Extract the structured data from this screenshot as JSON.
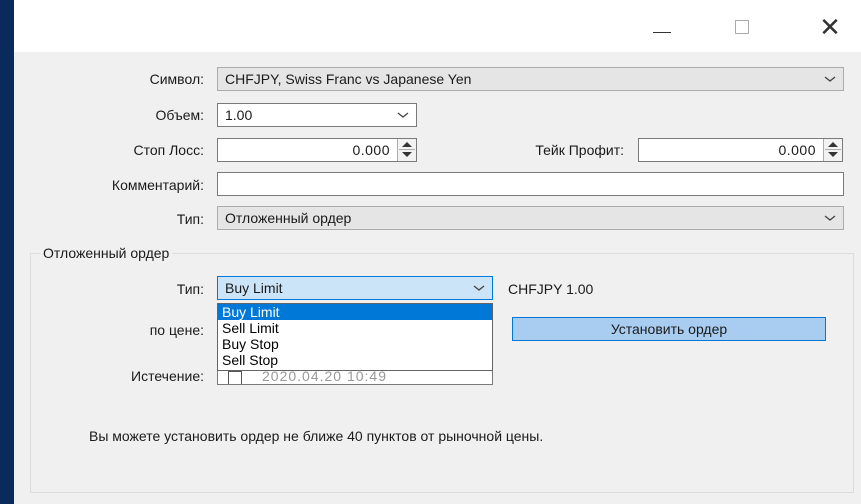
{
  "window": {
    "minimize_icon": "minimize-icon",
    "maximize_icon": "maximize-icon",
    "close_icon": "close-icon"
  },
  "form": {
    "symbol_label": "Символ:",
    "symbol_value": "CHFJPY, Swiss Franc vs Japanese Yen",
    "volume_label": "Объем:",
    "volume_value": "1.00",
    "stoploss_label": "Стоп Лосс:",
    "stoploss_value": "0.000",
    "takeprofit_label": "Тейк Профит:",
    "takeprofit_value": "0.000",
    "comment_label": "Комментарий:",
    "comment_value": "",
    "type_label": "Тип:",
    "type_value": "Отложенный ордер"
  },
  "pending": {
    "group_title": "Отложенный ордер",
    "type_label": "Тип:",
    "type_value": "Buy Limit",
    "type_options": [
      "Buy Limit",
      "Sell Limit",
      "Buy Stop",
      "Sell Stop"
    ],
    "symbol_info": "CHFJPY 1.00",
    "price_label": "по цене:",
    "set_order_button": "Установить ордер",
    "expiry_label": "Истечение:",
    "expiry_value": "2020.04.20 10:49",
    "note": "Вы можете установить ордер не ближе 40 пунктов от рыночной цены."
  },
  "colors": {
    "accent": "#0078d7",
    "button_bg": "#a9cdf1",
    "desktop": "#0b2a5c"
  }
}
